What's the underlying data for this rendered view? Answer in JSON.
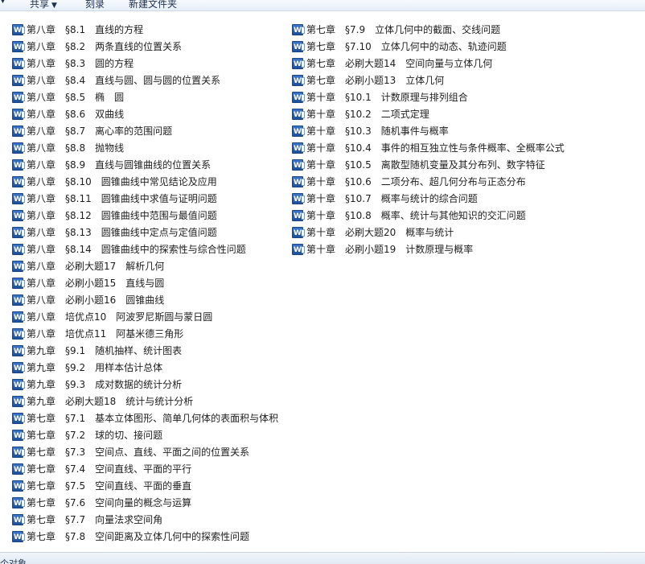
{
  "toolbar": {
    "share_label": "共享",
    "burn_label": "刻录",
    "new_folder_label": "新建文件夹"
  },
  "icon_colors": {
    "word_blue": "#2b5fb4"
  },
  "files_col1": [
    "第八章　§8.1　直线的方程",
    "第八章　§8.2　两条直线的位置关系",
    "第八章　§8.3　圆的方程",
    "第八章　§8.4　直线与圆、圆与圆的位置关系",
    "第八章　§8.5　椭　圆",
    "第八章　§8.6　双曲线",
    "第八章　§8.7　离心率的范围问题",
    "第八章　§8.8　抛物线",
    "第八章　§8.9　直线与圆锥曲线的位置关系",
    "第八章　§8.10　圆锥曲线中常见结论及应用",
    "第八章　§8.11　圆锥曲线中求值与证明问题",
    "第八章　§8.12　圆锥曲线中范围与最值问题",
    "第八章　§8.13　圆锥曲线中定点与定值问题",
    "第八章　§8.14　圆锥曲线中的探索性与综合性问题",
    "第八章　必刷大题17　解析几何",
    "第八章　必刷小题15　直线与圆",
    "第八章　必刷小题16　圆锥曲线",
    "第八章　培优点10　阿波罗尼斯圆与蒙日圆",
    "第八章　培优点11　阿基米德三角形",
    "第九章　§9.1　随机抽样、统计图表",
    "第九章　§9.2　用样本估计总体",
    "第九章　§9.3　成对数据的统计分析",
    "第九章　必刷大题18　统计与统计分析",
    "第七章　§7.1　基本立体图形、简单几何体的表面积与体积",
    "第七章　§7.2　球的切、接问题",
    "第七章　§7.3　空间点、直线、平面之间的位置关系",
    "第七章　§7.4　空间直线、平面的平行",
    "第七章　§7.5　空间直线、平面的垂直",
    "第七章　§7.6　空间向量的概念与运算",
    "第七章　§7.7　向量法求空间角",
    "第七章　§7.8　空间距离及立体几何中的探索性问题"
  ],
  "files_col2": [
    "第七章　§7.9　立体几何中的截面、交线问题",
    "第七章　§7.10　立体几何中的动态、轨迹问题",
    "第七章　必刷大题14　空间向量与立体几何",
    "第七章　必刷小题13　立体几何",
    "第十章　§10.1　计数原理与排列组合",
    "第十章　§10.2　二项式定理",
    "第十章　§10.3　随机事件与概率",
    "第十章　§10.4　事件的相互独立性与条件概率、全概率公式",
    "第十章　§10.5　离散型随机变量及其分布列、数字特征",
    "第十章　§10.6　二项分布、超几何分布与正态分布",
    "第十章　§10.7　概率与统计的综合问题",
    "第十章　§10.8　概率、统计与其他知识的交汇问题",
    "第十章　必刷大题20　概率与统计",
    "第十章　必刷小题19　计数原理与概率"
  ],
  "statusbar": {
    "text": "个对象"
  }
}
